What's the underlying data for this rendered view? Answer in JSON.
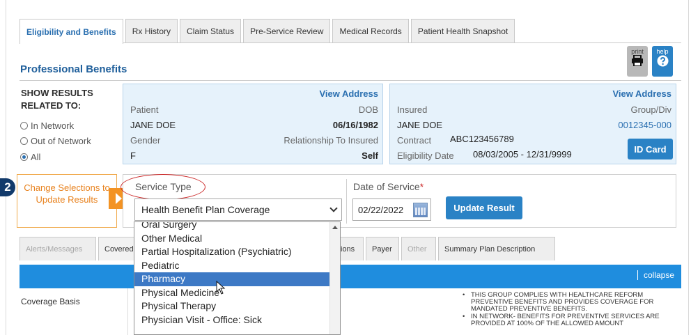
{
  "tabs": [
    {
      "label": "Eligibility and Benefits",
      "active": true
    },
    {
      "label": "Rx History"
    },
    {
      "label": "Claim Status"
    },
    {
      "label": "Pre-Service Review"
    },
    {
      "label": "Medical Records"
    },
    {
      "label": "Patient Health Snapshot"
    }
  ],
  "page_title": "Professional Benefits",
  "toolbar": {
    "print_label": "print",
    "help_label": "help",
    "print_icon": "printer-icon",
    "help_icon": "question-circle-icon"
  },
  "show_results": {
    "label": "SHOW RESULTS RELATED TO:",
    "options": [
      {
        "label": "In Network",
        "selected": false
      },
      {
        "label": "Out of Network",
        "selected": false
      },
      {
        "label": "All",
        "selected": true
      }
    ]
  },
  "patient": {
    "view_address": "View Address",
    "patient_label": "Patient",
    "patient_name": "JANE DOE",
    "dob_label": "DOB",
    "dob": "06/16/1982",
    "gender_label": "Gender",
    "gender": "F",
    "relationship_label": "Relationship To Insured",
    "relationship": "Self"
  },
  "insured": {
    "view_address": "View Address",
    "insured_label": "Insured",
    "insured_name": "JANE DOE",
    "group_label": "Group/Div",
    "group": "0012345-000",
    "contract_label": "Contract",
    "contract": "ABC123456789",
    "eligibility_label": "Eligibility Date",
    "eligibility": "08/03/2005 - 12/31/9999",
    "id_card": "ID Card"
  },
  "step": {
    "number": "2",
    "text": "Change Selections to Update Results"
  },
  "service": {
    "label": "Service Type",
    "selected": "Health Benefit Plan Coverage",
    "options": [
      "Oral Surgery",
      "Other Medical",
      "Partial Hospitalization (Psychiatric)",
      "Pediatric",
      "Pharmacy",
      "Physical Medicine",
      "Physical Therapy",
      "Physician Visit - Office: Sick"
    ],
    "highlighted": "Pharmacy"
  },
  "date_of_service": {
    "label": "Date of Service",
    "required_mark": "*",
    "value": "02/22/2022",
    "icon": "calendar-icon"
  },
  "update_button": "Update Result",
  "lower_tabs": {
    "alerts": "Alerts/Messages",
    "covered": "Covered",
    "ions": "ions",
    "payer": "Payer",
    "other": "Other",
    "summary": "Summary Plan Description"
  },
  "collapse": "collapse",
  "coverage_basis": "Coverage Basis",
  "notes": [
    "THIS GROUP COMPLIES WITH HEALTHCARE REFORM PREVENTIVE BENEFITS AND PROVIDES COVERAGE FOR MANDATED PREVENTIVE BENEFITS.",
    "IN NETWORK- BENEFITS FOR PREVENTIVE SERVICES ARE PROVIDED AT 100% OF THE ALLOWED AMOUNT"
  ],
  "colors": {
    "accent": "#2a82c5",
    "title": "#1f5f9b",
    "orange": "#f39324",
    "highlight": "#3d79c5"
  }
}
